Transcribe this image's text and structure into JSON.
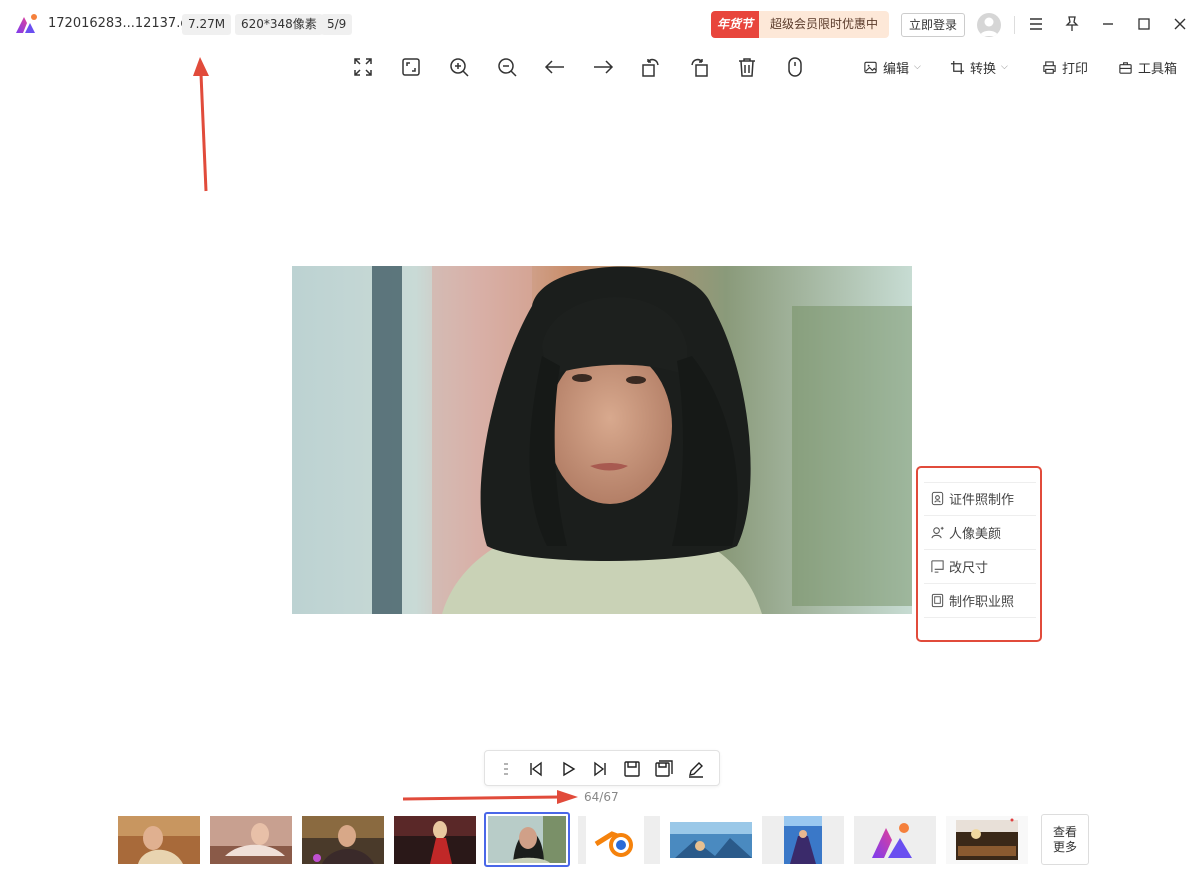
{
  "title_bar": {
    "file_name": "172016283...12137.gif",
    "file_size": "7.27M",
    "dimensions": "620*348像素",
    "position": "5/9",
    "promo_tag": "年货节",
    "promo_text": "超级会员限时优惠中",
    "login_label": "立即登录"
  },
  "toolbar": {
    "icons": [
      "expand-icon",
      "fit-screen-icon",
      "zoom-in-icon",
      "zoom-out-icon",
      "previous-arrow-icon",
      "next-arrow-icon",
      "rotate-left-icon",
      "rotate-right-icon",
      "delete-icon",
      "mouse-icon"
    ],
    "edit_label": "编辑",
    "convert_label": "转换",
    "print_label": "打印",
    "toolbox_label": "工具箱"
  },
  "side_panel": {
    "items": [
      {
        "label": "证件照制作",
        "icon": "id-photo-icon"
      },
      {
        "label": "人像美颜",
        "icon": "portrait-beauty-icon"
      },
      {
        "label": "改尺寸",
        "icon": "resize-icon"
      },
      {
        "label": "制作职业照",
        "icon": "professional-photo-icon"
      }
    ]
  },
  "playbar": {
    "icons": [
      "list-icon",
      "skip-back-icon",
      "play-icon",
      "skip-forward-icon",
      "save-frame-icon",
      "save-all-frames-icon",
      "edit-pen-icon"
    ],
    "frame_counter": "64/67"
  },
  "thumbnails": {
    "count": 10,
    "selected_index": 4,
    "more_label_line1": "查看",
    "more_label_line2": "更多"
  },
  "colors": {
    "annotation_red": "#e14b3b",
    "selection_blue": "#4a67e8",
    "promo_red": "#e8453c"
  }
}
